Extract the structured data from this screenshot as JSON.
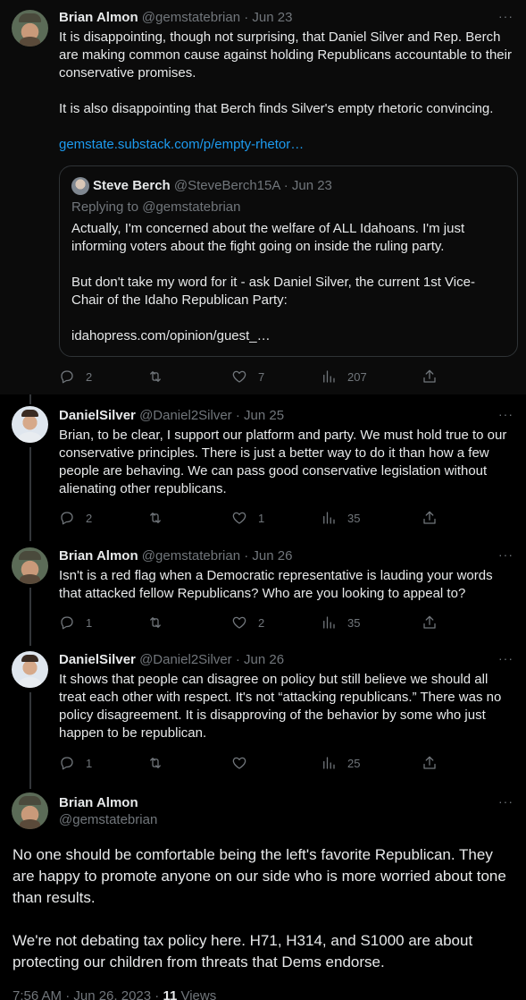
{
  "tweets": [
    {
      "name": "Brian Almon",
      "handle": "@gemstatebrian",
      "date": "· Jun 23",
      "paragraphs": [
        "It is disappointing, though not surprising, that Daniel Silver and Rep. Berch are making common cause against holding Republicans accountable to their conservative promises.",
        "It is also disappointing that Berch finds Silver's empty rhetoric convincing."
      ],
      "link": "gemstate.substack.com/p/empty-rhetor…",
      "quote": {
        "name": "Steve Berch",
        "handle": "@SteveBerch15A",
        "date": "· Jun 23",
        "replying_to": "Replying to @gemstatebrian",
        "paragraphs": [
          "Actually, I'm concerned about the welfare of ALL Idahoans. I'm just informing voters about the fight going on inside the ruling party.",
          "But don't take my word for it - ask Daniel Silver, the current 1st Vice-Chair of the Idaho Republican Party:",
          "idahopress.com/opinion/guest_…"
        ]
      },
      "replies": "2",
      "retweets": "",
      "likes": "7",
      "views": "207"
    },
    {
      "name": "DanielSilver",
      "handle": "@Daniel2Silver",
      "date": "· Jun 25",
      "paragraphs": [
        "Brian, to be clear, I support our platform and party. We must hold true to our conservative principles. There is just a better way to do it than how a few people are behaving. We can pass good conservative legislation without alienating other republicans."
      ],
      "replies": "2",
      "retweets": "",
      "likes": "1",
      "views": "35"
    },
    {
      "name": "Brian Almon",
      "handle": "@gemstatebrian",
      "date": "· Jun 26",
      "paragraphs": [
        "Isn't is a red flag when a Democratic representative is lauding your words that attacked fellow Republicans? Who are you looking to appeal to?"
      ],
      "replies": "1",
      "retweets": "",
      "likes": "2",
      "views": "35"
    },
    {
      "name": "DanielSilver",
      "handle": "@Daniel2Silver",
      "date": "· Jun 26",
      "paragraphs": [
        "It shows that people can disagree on policy but still believe we should all treat each other with respect. It's not “attacking republicans.” There was no policy disagreement. It is disapproving of the behavior by some who just happen to be republican."
      ],
      "replies": "1",
      "retweets": "",
      "likes": "",
      "views": "25"
    }
  ],
  "main_tweet": {
    "name": "Brian Almon",
    "handle": "@gemstatebrian",
    "paragraphs": [
      "No one should be comfortable being the left's favorite Republican. They are happy to promote anyone on our side who is more worried about tone than results.",
      "We're not debating tax policy here. H71, H314, and S1000 are about protecting our children from threats that Dems endorse."
    ],
    "time": "7:56 AM · Jun 26, 2023 · ",
    "views_count": "11",
    "views_label": " Views"
  },
  "more_icon": "···",
  "colors": {
    "background": "#000000",
    "text": "#e7e9ea",
    "secondary": "#71767b",
    "link": "#1d9bf0",
    "border": "#2f3336"
  },
  "icons": [
    "reply-icon",
    "retweet-icon",
    "like-icon",
    "views-icon",
    "share-icon",
    "more-icon"
  ]
}
